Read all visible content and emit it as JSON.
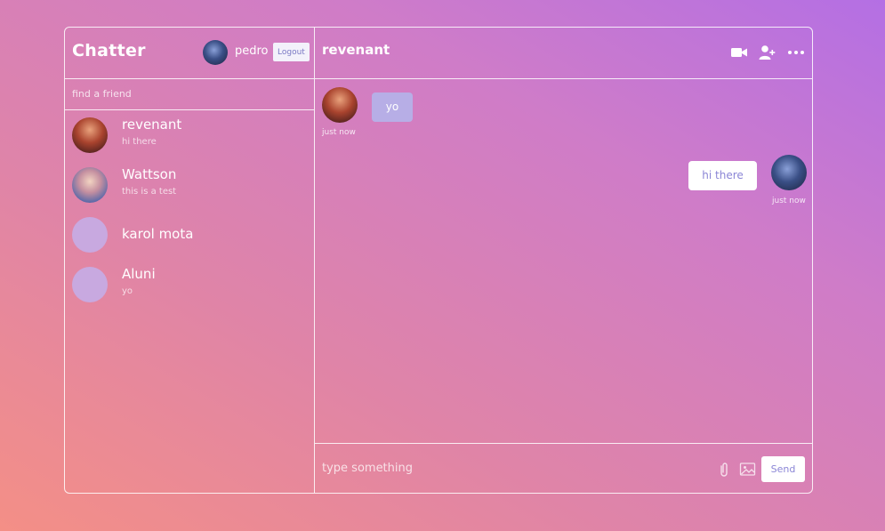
{
  "app": {
    "brand": "Chatter"
  },
  "user": {
    "name": "pedro",
    "logout_label": "Logout"
  },
  "search": {
    "placeholder": "find a friend"
  },
  "chats": [
    {
      "name": "revenant",
      "preview": "hi there",
      "avatar": "revenant"
    },
    {
      "name": "Wattson",
      "preview": "this is a test",
      "avatar": "wattson"
    },
    {
      "name": "karol mota",
      "preview": "",
      "avatar": "empty"
    },
    {
      "name": "Aluni",
      "preview": "yo",
      "avatar": "empty"
    }
  ],
  "conversation": {
    "contact_name": "revenant",
    "header_icons": [
      "video-camera-icon",
      "add-user-icon",
      "more-options-icon"
    ],
    "messages": [
      {
        "direction": "incoming",
        "text": "yo",
        "time": "just now"
      },
      {
        "direction": "outgoing",
        "text": "hi there",
        "time": "just now"
      }
    ]
  },
  "composer": {
    "placeholder": "type something",
    "send_label": "Send",
    "icons": [
      "paperclip-icon",
      "image-icon"
    ]
  },
  "colors": {
    "bubble_incoming": "#b7aee6",
    "bubble_outgoing": "#ffffff",
    "accent_text": "#8b86d6"
  }
}
